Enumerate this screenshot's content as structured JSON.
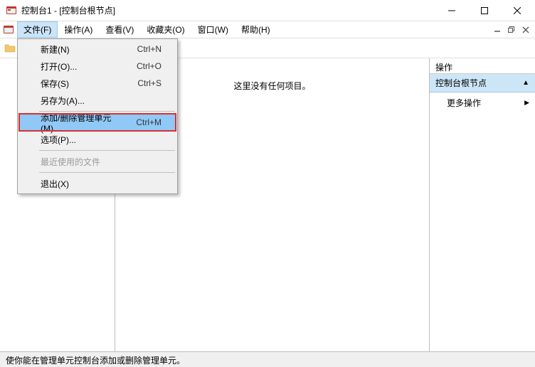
{
  "window": {
    "title": "控制台1 - [控制台根节点]"
  },
  "menubar": {
    "items": [
      {
        "label": "文件(F)"
      },
      {
        "label": "操作(A)"
      },
      {
        "label": "查看(V)"
      },
      {
        "label": "收藏夹(O)"
      },
      {
        "label": "窗口(W)"
      },
      {
        "label": "帮助(H)"
      }
    ]
  },
  "dropdown": {
    "items": [
      {
        "label": "新建(N)",
        "shortcut": "Ctrl+N"
      },
      {
        "label": "打开(O)...",
        "shortcut": "Ctrl+O"
      },
      {
        "label": "保存(S)",
        "shortcut": "Ctrl+S"
      },
      {
        "label": "另存为(A)...",
        "shortcut": ""
      },
      {
        "label": "添加/删除管理单元(M)...",
        "shortcut": "Ctrl+M"
      },
      {
        "label": "选项(P)...",
        "shortcut": ""
      },
      {
        "label": "最近使用的文件",
        "shortcut": ""
      },
      {
        "label": "退出(X)",
        "shortcut": ""
      }
    ]
  },
  "main": {
    "empty_message": "这里没有任何项目。"
  },
  "actions": {
    "header": "操作",
    "section": "控制台根节点",
    "more": "更多操作"
  },
  "statusbar": {
    "text": "使你能在管理单元控制台添加或删除管理单元。"
  }
}
